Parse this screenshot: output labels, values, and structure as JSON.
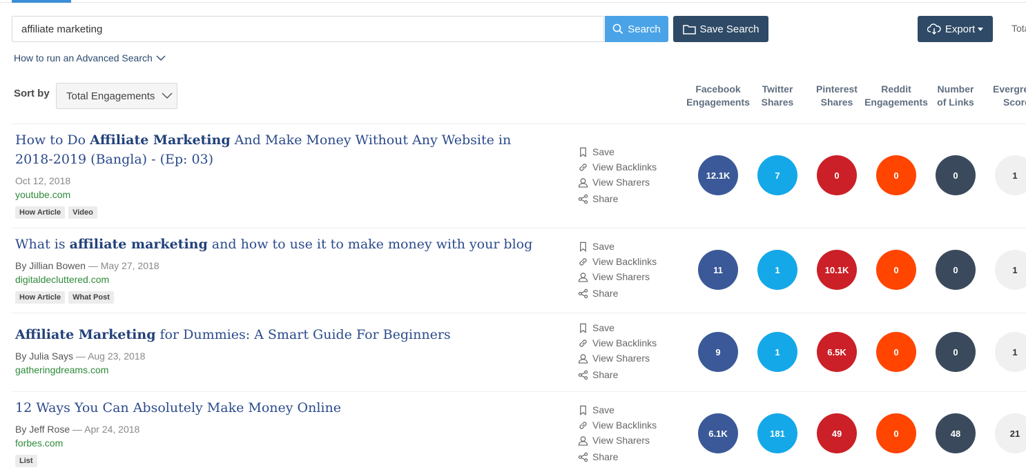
{
  "search": {
    "query": "affiliate marketing",
    "search_label": "Search",
    "save_search_label": "Save Search",
    "export_label": "Export",
    "total_label_cut": "Tota"
  },
  "advanced_search_link": "How to run an Advanced Search",
  "sort": {
    "label": "Sort by",
    "selected": "Total Engagements"
  },
  "columns": [
    {
      "line1": "Facebook",
      "line2": "Engagements"
    },
    {
      "line1": "Twitter",
      "line2": "Shares"
    },
    {
      "line1": "Pinterest",
      "line2": "Shares"
    },
    {
      "line1": "Reddit",
      "line2": "Engagements"
    },
    {
      "line1": "Number",
      "line2": "of Links"
    },
    {
      "line1": "Evergre",
      "line2": "Score"
    }
  ],
  "actions": {
    "save": "Save",
    "backlinks": "View Backlinks",
    "sharers": "View Sharers",
    "share": "Share"
  },
  "colors": {
    "facebook": "#3b5998",
    "twitter": "#14a8e8",
    "pinterest": "#cb2027",
    "reddit": "#ff4500",
    "links": "#3a4a5c",
    "evergreen": "#f0f0f0"
  },
  "results": [
    {
      "title_pre": "How to Do ",
      "title_bold": "Affiliate Marketing",
      "title_post": " And Make Money Without Any Website in 2018-2019 (Bangla) - (Ep: 03)",
      "author": "",
      "separator": "",
      "date": "Oct 12, 2018",
      "domain": "youtube.com",
      "tags": [
        "How Article",
        "Video"
      ],
      "metrics": [
        "12.1K",
        "7",
        "0",
        "0",
        "0",
        "1"
      ]
    },
    {
      "title_pre": "What is ",
      "title_bold": "affiliate marketing",
      "title_post": " and how to use it to make money with your blog",
      "author": "By Jillian Bowen",
      "separator": " — ",
      "date": "May 27, 2018",
      "domain": "digitaldecluttered.com",
      "tags": [
        "How Article",
        "What Post"
      ],
      "metrics": [
        "11",
        "1",
        "10.1K",
        "0",
        "0",
        "1"
      ]
    },
    {
      "title_pre": "",
      "title_bold": "Affiliate Marketing",
      "title_post": " for Dummies: A Smart Guide For Beginners",
      "author": "By Julia Says",
      "separator": " — ",
      "date": "Aug 23, 2018",
      "domain": "gatheringdreams.com",
      "tags": [],
      "metrics": [
        "9",
        "1",
        "6.5K",
        "0",
        "0",
        "1"
      ]
    },
    {
      "title_pre": "12 Ways You Can Absolutely Make Money Online",
      "title_bold": "",
      "title_post": "",
      "author": "By Jeff Rose",
      "separator": " — ",
      "date": "Apr 24, 2018",
      "domain": "forbes.com",
      "tags": [
        "List"
      ],
      "metrics": [
        "6.1K",
        "181",
        "49",
        "0",
        "48",
        "21"
      ]
    }
  ]
}
